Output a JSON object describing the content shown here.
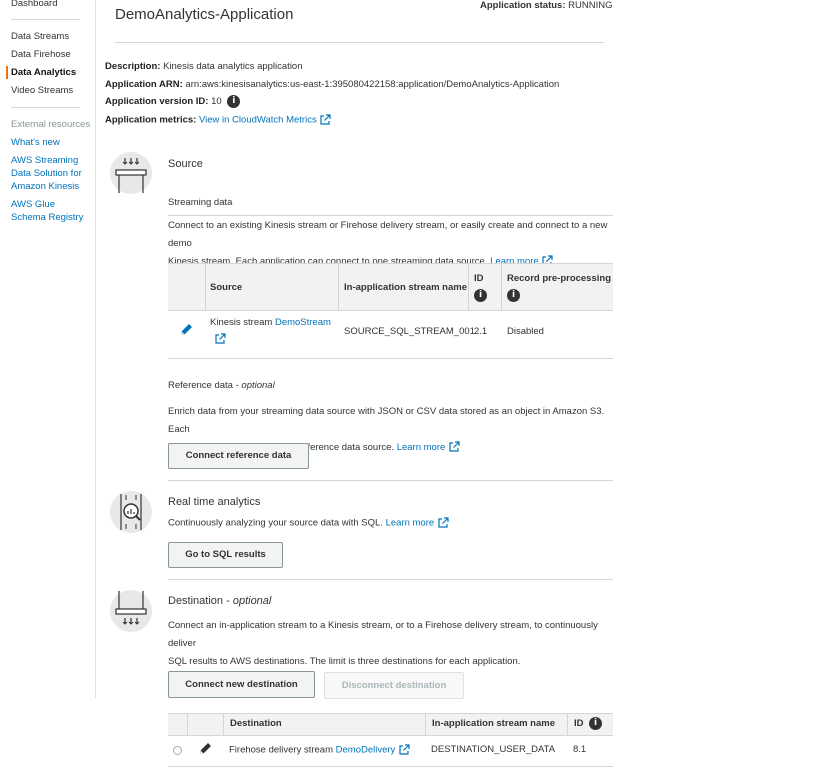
{
  "sidebar": {
    "dashboard": "Dashboard",
    "items": [
      "Data Streams",
      "Data Firehose",
      "Data Analytics",
      "Video Streams"
    ],
    "external_label": "External resources",
    "links": [
      "What's new",
      "AWS Streaming Data Solution for Amazon Kinesis",
      "AWS Glue Schema Registry"
    ]
  },
  "header": {
    "title": "DemoAnalytics-Application",
    "status_label": "Application status:",
    "status_value": "RUNNING"
  },
  "meta": {
    "description_label": "Description:",
    "description_value": "Kinesis data analytics application",
    "arn_label": "Application ARN:",
    "arn_value": "arn:aws:kinesisanalytics:us-east-1:395080422158:application/DemoAnalytics-Application",
    "version_label": "Application version ID:",
    "version_value": "10",
    "metrics_label": "Application metrics:",
    "metrics_link": "View in CloudWatch Metrics"
  },
  "source": {
    "title": "Source",
    "streaming_label": "Streaming data",
    "streaming_text_1": "Connect to an existing Kinesis stream or Firehose delivery stream, or easily create and connect to a new demo",
    "streaming_text_2": "Kinesis stream. Each application can connect to one streaming data source.",
    "learn_more": "Learn more",
    "table": {
      "headers": [
        "Source",
        "In-application stream name",
        "ID",
        "Record pre-processing"
      ],
      "row": {
        "source_prefix": "Kinesis stream",
        "source_link": "DemoStream",
        "stream_name": "SOURCE_SQL_STREAM_001",
        "id": "2.1",
        "preprocessing": "Disabled"
      }
    },
    "reference_label": "Reference data -",
    "reference_optional": "optional",
    "reference_text_1": "Enrich data from your streaming data source with JSON or CSV data stored as an object in Amazon S3. Each",
    "reference_text_2": "application can connect to one reference data source.",
    "reference_learn_more": "Learn more",
    "connect_reference_button": "Connect reference data"
  },
  "analytics": {
    "title": "Real time analytics",
    "text": "Continuously analyzing your source data with SQL.",
    "learn_more": "Learn more",
    "sql_button": "Go to SQL results"
  },
  "destination": {
    "title": "Destination -",
    "title_optional": "optional",
    "text_1": "Connect an in-application stream to a Kinesis stream, or to a Firehose delivery stream, to continuously deliver",
    "text_2": "SQL results to AWS destinations. The limit is three destinations for each application.",
    "connect_button": "Connect new destination",
    "disconnect_button": "Disconnect destination",
    "table": {
      "headers": [
        "Destination",
        "In-application stream name",
        "ID"
      ],
      "row": {
        "dest_prefix": "Firehose delivery stream",
        "dest_link": "DemoDelivery",
        "stream_name": "DESTINATION_USER_DATA",
        "id": "8.1"
      }
    }
  }
}
